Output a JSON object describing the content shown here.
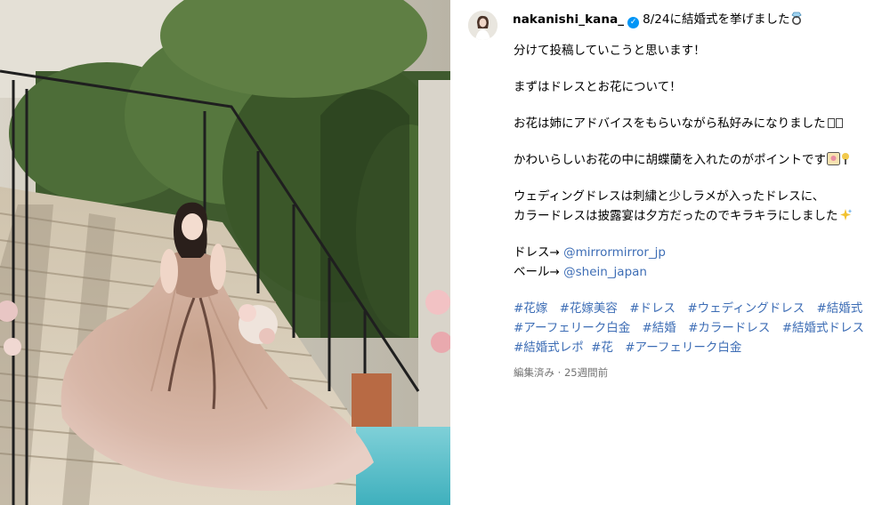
{
  "post": {
    "username": "nakanishi_kana_",
    "title_text": "8/24に結婚式を挙げました",
    "lines": {
      "l1": "分けて投稿していこうと思います！",
      "l2": "まずはドレスとお花について！",
      "l3": "お花は姉にアドバイスをもらいながら私好みになりました",
      "l4": "かわいらしいお花の中に胡蝶蘭を入れたのがポイントです",
      "l5": "ウェディングドレスは刺繍と少しラメが入ったドレスに、",
      "l6": "カラードレスは披露宴は夕方だったのでキラキラにしました",
      "dress_label": "ドレス→ ",
      "dress_mention": "@mirrormirror_jp",
      "veil_label": "ベール→ ",
      "veil_mention": "@shein_japan"
    },
    "hashtags": [
      "#花嫁",
      "#花嫁美容",
      "#ドレス",
      "#ウェディングドレス",
      "#結婚式",
      "#アーフェリーク白金",
      "#結婚",
      "#カラードレス",
      "#結婚式ドレス",
      "#結婚式レポ",
      "#花",
      "#アーフェリーク白金"
    ],
    "meta": "編集済み · 25週間前"
  },
  "icons": {
    "verified": "verified-badge-icon",
    "ring": "ring-emoji-icon",
    "flower_emoji": "flower-emoji-icon",
    "sparkles": "sparkles-emoji-icon"
  },
  "colors": {
    "link": "#3d6db5",
    "meta": "#737373",
    "verified": "#0095f6"
  }
}
